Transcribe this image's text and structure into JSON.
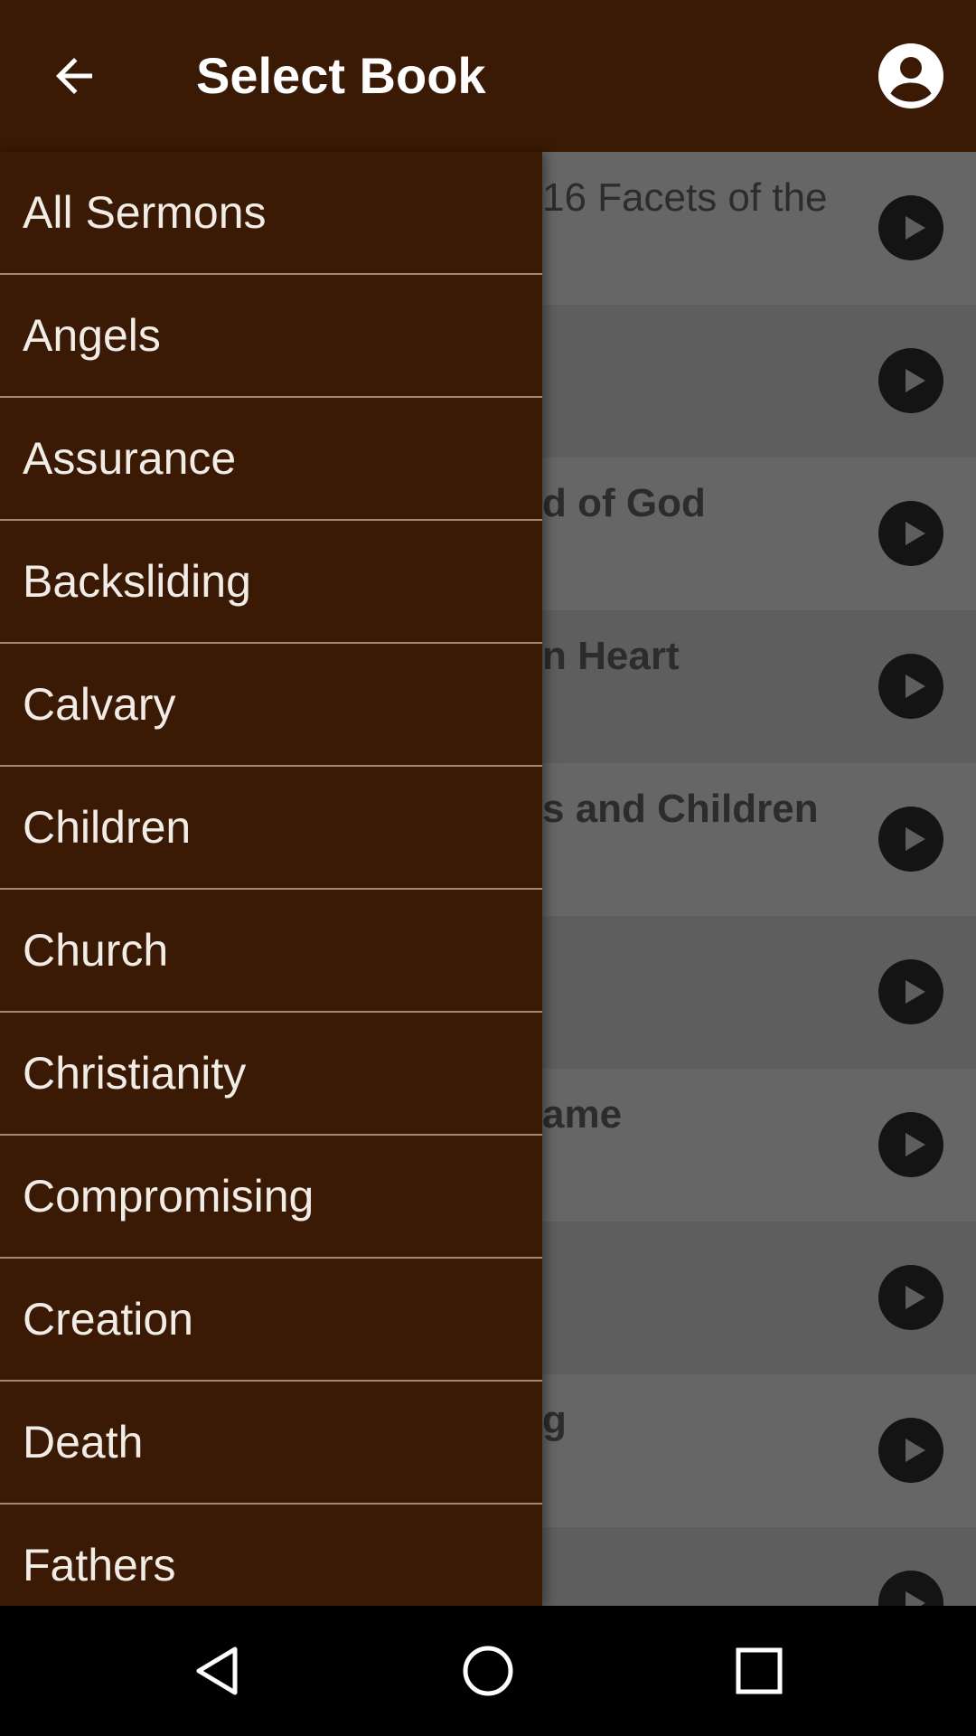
{
  "header": {
    "title": "Select Book",
    "back_icon": "arrow-left-icon",
    "account_icon": "account-circle-icon"
  },
  "background_list": {
    "items": [
      {
        "text": "16 Facets of the",
        "bold": false
      },
      {
        "text": "",
        "bold": true
      },
      {
        "text": "d of God",
        "bold": true
      },
      {
        "text": "n Heart",
        "bold": true
      },
      {
        "text": "s and Children",
        "bold": true
      },
      {
        "text": "",
        "bold": true
      },
      {
        "text": "ame",
        "bold": true
      },
      {
        "text": "",
        "bold": true
      },
      {
        "text": "g",
        "bold": true
      },
      {
        "text": "",
        "bold": true
      }
    ]
  },
  "drawer": {
    "items": [
      "All Sermons",
      "Angels",
      "Assurance",
      "Backsliding",
      "Calvary",
      "Children",
      "Church",
      "Christianity",
      "Compromising",
      "Creation",
      "Death",
      "Fathers"
    ]
  },
  "colors": {
    "header": "#3a1a05",
    "divider": "#a58a6c",
    "scrim": "#666666"
  }
}
